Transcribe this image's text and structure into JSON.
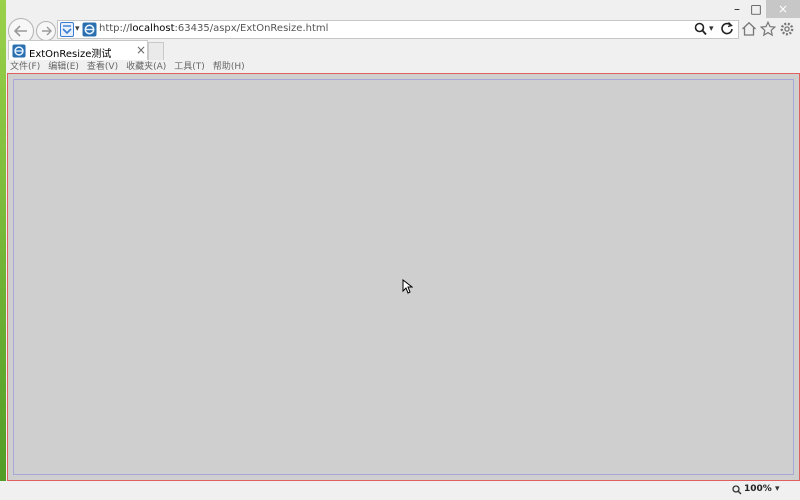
{
  "window": {
    "minimize_glyph": "–",
    "maximize_glyph": "□",
    "close_glyph": "×"
  },
  "address": {
    "url_prefix": "http://",
    "url_host": "localhost",
    "url_rest": ":63435/aspx/ExtOnResize.html"
  },
  "tab": {
    "title": "ExtOnResize测试",
    "close_glyph": "×"
  },
  "menu": [
    "文件(F)",
    "编辑(E)",
    "查看(V)",
    "收藏夹(A)",
    "工具(T)",
    "帮助(H)"
  ],
  "status": {
    "zoom": "100%"
  },
  "icons": {
    "back": "back-arrow-icon",
    "forward": "forward-arrow-icon",
    "compat": "compatibility-view-icon",
    "site": "ie-page-icon",
    "search": "search-icon",
    "refresh": "refresh-icon",
    "home": "home-icon",
    "favorites": "star-icon",
    "tools": "gear-icon",
    "zoom": "zoom-icon"
  },
  "colors": {
    "content_bg": "#cfcfcf",
    "content_border": "#e06060",
    "inner_border": "#a7a7d8",
    "close_button_bg": "#c7c7c7"
  }
}
